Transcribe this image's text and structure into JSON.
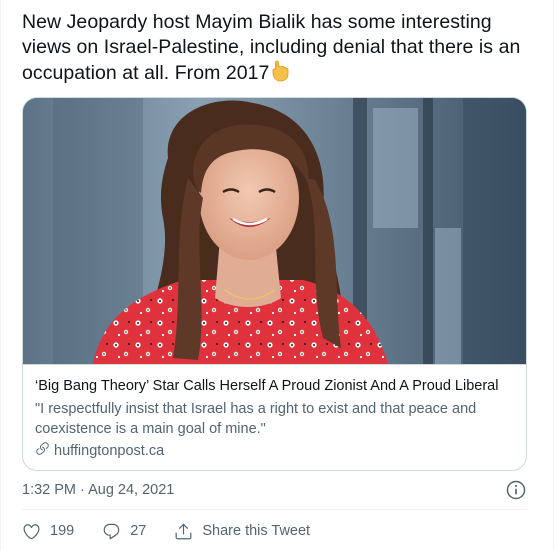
{
  "tweet": {
    "text": "New Jeopardy host Mayim Bialik has some interesting views on Israel-Palestine, including denial that there is an occupation at all. From 2017",
    "emoji_icon": "pointing-down-hand-emoji"
  },
  "card": {
    "image_alt": "photo-of-smiling-woman",
    "title": "‘Big Bang Theory’ Star Calls Herself A Proud Zionist And A Proud Liberal",
    "description": "\"I respectfully insist that Israel has a right to exist and that peace and coexistence is a main goal of mine.\"",
    "domain": "huffingtonpost.ca",
    "link_icon": "link-icon"
  },
  "meta": {
    "timestamp": "1:32 PM · Aug 24, 2021",
    "info_icon": "info-icon"
  },
  "actions": {
    "like_count": "199",
    "reply_count": "27",
    "share_label": "Share this Tweet"
  },
  "colors": {
    "text_primary": "#0f1419",
    "text_secondary": "#536471",
    "border": "#cfd9de"
  }
}
